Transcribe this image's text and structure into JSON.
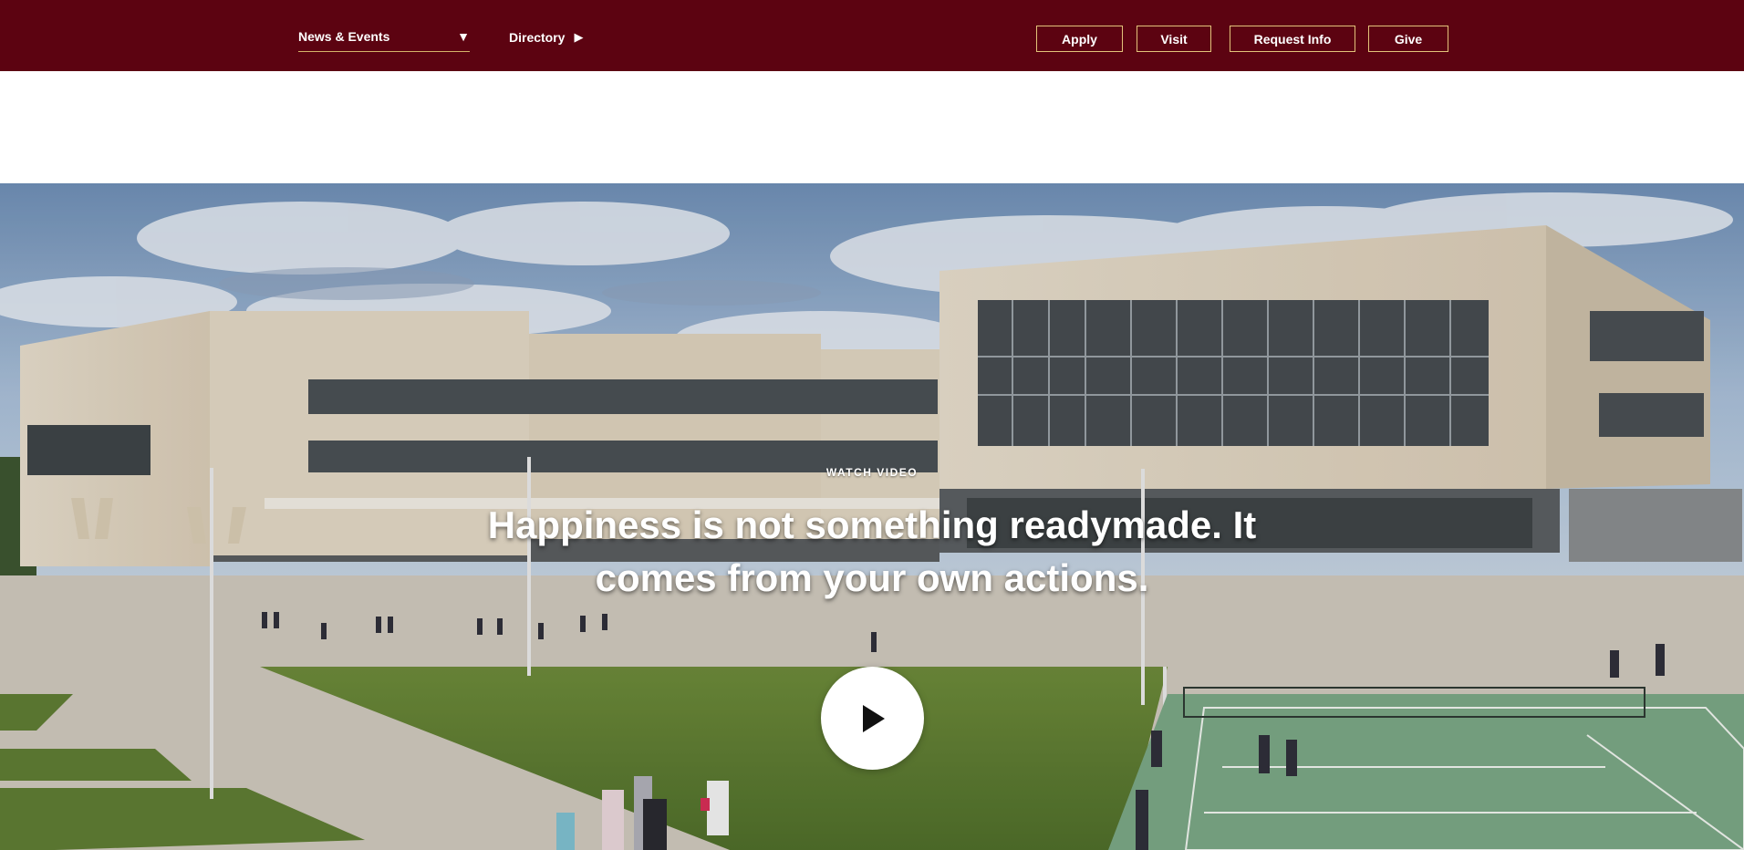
{
  "nav": {
    "news_events": "News & Events",
    "news_events_icon": "caret-down-icon",
    "directory": "Directory",
    "directory_icon": "caret-right-icon"
  },
  "actions": {
    "apply": "Apply",
    "visit": "Visit",
    "request_info": "Request Info",
    "give": "Give"
  },
  "hero": {
    "eyebrow": "WATCH VIDEO",
    "headline": "Happiness is not something readymade. It comes from your own actions.",
    "play_icon": "play-icon"
  },
  "colors": {
    "brand": "#5c0311",
    "button_border": "#e3c37a"
  }
}
